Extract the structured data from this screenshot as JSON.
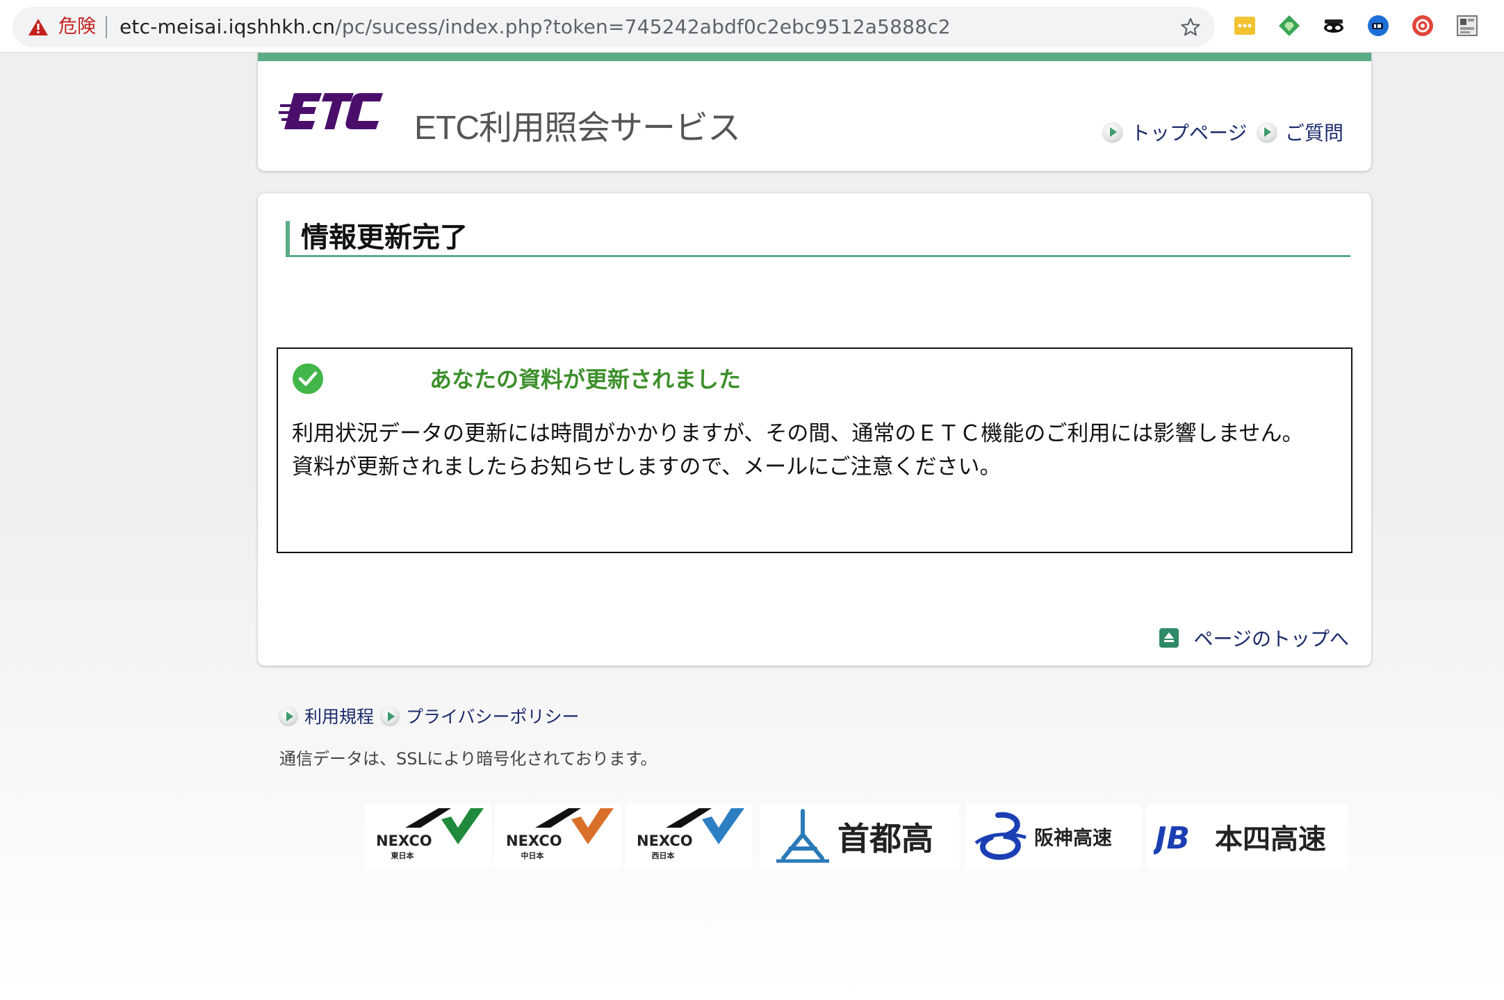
{
  "browser": {
    "security_label": "危険",
    "url_host": "etc-meisai.iqshhkh.cn",
    "url_path": "/pc/sucess/index.php?token=745242abdf0c2ebc9512a5888c2",
    "extensions": [
      "notes-extension-icon",
      "diamond-extension-icon",
      "mask-extension-icon",
      "blue-circle-extension-icon",
      "red-circle-extension-icon",
      "grid-extension-icon"
    ]
  },
  "header": {
    "logo_text": "ETC",
    "service_title": "ETC利用照会サービス",
    "nav": {
      "top_page": "トップページ",
      "faq": "ご質問"
    }
  },
  "main": {
    "heading": "情報更新完了",
    "notice": {
      "title": "あなたの資料が更新されました",
      "line1": "利用状況データの更新には時間がかかりますが、その間、通常のＥＴＣ機能のご利用には影響しません。",
      "line2": "資料が更新されましたらお知らせしますので、メールにご注意ください。"
    },
    "page_top_link": "ページのトップへ"
  },
  "footer": {
    "links": {
      "terms": "利用規程",
      "privacy": "プライバシーポリシー"
    },
    "ssl_note": "通信データは、SSLにより暗号化されております。",
    "partner_logos": {
      "nexco_east": {
        "name": "NEXCO",
        "sub": "東日本"
      },
      "nexco_central": {
        "name": "NEXCO",
        "sub": "中日本"
      },
      "nexco_west": {
        "name": "NEXCO",
        "sub": "西日本"
      },
      "shutoko": {
        "name": "首都高"
      },
      "hanshin": {
        "name": "阪神高速"
      },
      "honshi": {
        "mark": "JB",
        "name": "本四高速"
      }
    }
  },
  "colors": {
    "accent_green": "#5aab86",
    "notice_title_green": "#3d8f2b",
    "link_navy": "#1a2a6b",
    "etc_purple": "#4b0f6b",
    "danger_red": "#c5221f"
  }
}
